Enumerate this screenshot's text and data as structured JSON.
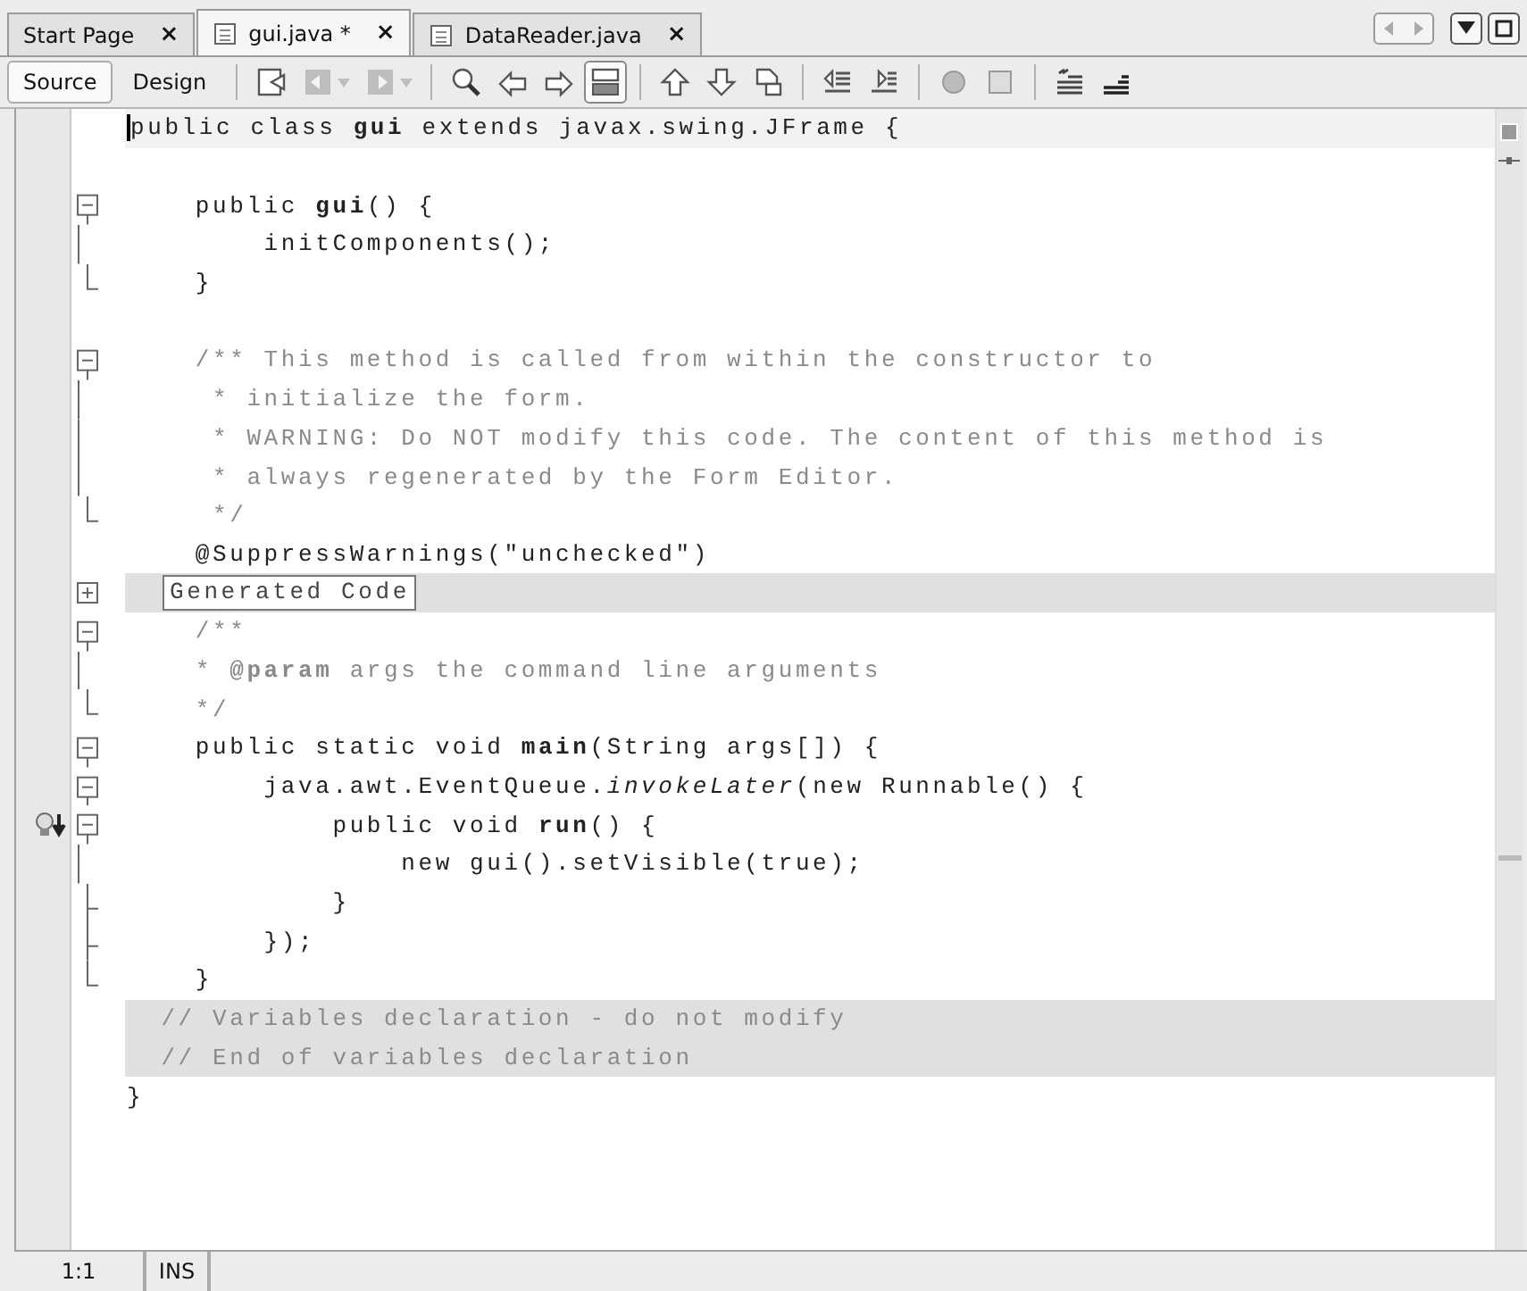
{
  "tabs": [
    {
      "label": "Start Page",
      "icon": false,
      "selected": false,
      "close": "×"
    },
    {
      "label": "gui.java *",
      "icon": true,
      "selected": true,
      "close": "×"
    },
    {
      "label": "DataReader.java",
      "icon": true,
      "selected": false,
      "close": "×"
    }
  ],
  "view_buttons": [
    {
      "label": "Source",
      "selected": true
    },
    {
      "label": "Design",
      "selected": false
    }
  ],
  "tool_groups": [
    [
      {
        "kind": "last-edit",
        "disabled": false,
        "selected": false,
        "dropdown": false
      },
      {
        "kind": "back",
        "disabled": true,
        "selected": false,
        "dropdown": true
      },
      {
        "kind": "forward",
        "disabled": true,
        "selected": false,
        "dropdown": true
      }
    ],
    [
      {
        "kind": "find",
        "disabled": false,
        "selected": false,
        "dropdown": false
      },
      {
        "kind": "find-prev",
        "disabled": false,
        "selected": false,
        "dropdown": false
      },
      {
        "kind": "find-next",
        "disabled": false,
        "selected": false,
        "dropdown": false
      },
      {
        "kind": "highlight",
        "disabled": false,
        "selected": true,
        "dropdown": false
      }
    ],
    [
      {
        "kind": "bookmark-prev",
        "disabled": false,
        "selected": false,
        "dropdown": false
      },
      {
        "kind": "bookmark-next",
        "disabled": false,
        "selected": false,
        "dropdown": false
      },
      {
        "kind": "bookmark-toggle",
        "disabled": false,
        "selected": false,
        "dropdown": false
      }
    ],
    [
      {
        "kind": "shift-left",
        "disabled": false,
        "selected": false,
        "dropdown": false
      },
      {
        "kind": "shift-right",
        "disabled": false,
        "selected": false,
        "dropdown": false
      }
    ],
    [
      {
        "kind": "record",
        "disabled": false,
        "selected": false,
        "dropdown": false
      },
      {
        "kind": "stop",
        "disabled": false,
        "selected": false,
        "dropdown": false
      }
    ],
    [
      {
        "kind": "comment",
        "disabled": false,
        "selected": false,
        "dropdown": false
      },
      {
        "kind": "uncomment",
        "disabled": false,
        "selected": false,
        "dropdown": false
      }
    ]
  ],
  "lines": [
    {
      "kind": "code",
      "current": true,
      "text": "public class **gui** extends javax.swing.JFrame {"
    },
    {
      "kind": "code",
      "current": false
    },
    {
      "kind": "code",
      "current": false,
      "fold": {
        "kind": "start"
      },
      "text": "    public **gui**() {"
    },
    {
      "kind": "code",
      "current": false,
      "fold": {
        "kind": "middle"
      },
      "text": "        initComponents();"
    },
    {
      "kind": "code",
      "current": false,
      "fold": {
        "kind": "end"
      },
      "text": "    }"
    },
    {
      "kind": "code",
      "current": false
    },
    {
      "kind": "comment",
      "current": false,
      "fold": {
        "kind": "start"
      },
      "text": "    /** This method is called from within the constructor to"
    },
    {
      "kind": "comment",
      "current": false,
      "fold": {
        "kind": "middle"
      },
      "text": "     * initialize the form."
    },
    {
      "kind": "comment",
      "current": false,
      "fold": {
        "kind": "middle"
      },
      "text": "     * WARNING: Do NOT modify this code. The content of this method is"
    },
    {
      "kind": "comment",
      "current": false,
      "fold": {
        "kind": "middle"
      },
      "text": "     * always regenerated by the Form Editor."
    },
    {
      "kind": "comment",
      "current": false,
      "fold": {
        "kind": "end"
      },
      "text": "     */"
    },
    {
      "kind": "code",
      "current": false,
      "text": "    @SuppressWarnings(\"unchecked\")"
    },
    {
      "kind": "collapsed",
      "current": false,
      "fold": {
        "kind": "collapsed"
      },
      "text": "Generated Code"
    },
    {
      "kind": "comment",
      "current": false,
      "fold": {
        "kind": "start"
      },
      "text": "    /**"
    },
    {
      "kind": "comment",
      "current": false,
      "fold": {
        "kind": "middle"
      },
      "text": "    * **@param** args the command line arguments"
    },
    {
      "kind": "comment",
      "current": false,
      "fold": {
        "kind": "end"
      },
      "text": "    */"
    },
    {
      "kind": "code",
      "current": false,
      "fold": {
        "kind": "start"
      },
      "text": "    public static void **main**(String args[]) {"
    },
    {
      "kind": "code",
      "current": false,
      "fold": {
        "kind": "start"
      },
      "text": "        java.awt.EventQueue.*invokeLater*(new Runnable() {"
    },
    {
      "kind": "code",
      "current": false,
      "fold": {
        "kind": "start"
      },
      "hint": true,
      "text": "            public void **run**() {"
    },
    {
      "kind": "code",
      "current": false,
      "fold": {
        "kind": "middle"
      },
      "text": "                new gui().setVisible(true);"
    },
    {
      "kind": "code",
      "current": false,
      "fold": {
        "kind": "branch"
      },
      "text": "            }"
    },
    {
      "kind": "code",
      "current": false,
      "fold": {
        "kind": "branch"
      },
      "text": "        });"
    },
    {
      "kind": "code",
      "current": false,
      "fold": {
        "kind": "end"
      },
      "text": "    }"
    },
    {
      "kind": "guarded",
      "current": false,
      "text": "  // Variables declaration - do not modify"
    },
    {
      "kind": "guarded",
      "current": false,
      "text": "  // End of variables declaration"
    },
    {
      "kind": "code",
      "current": false,
      "text": "}"
    }
  ],
  "status_bar": {
    "position": "1:1",
    "mode": "INS"
  }
}
